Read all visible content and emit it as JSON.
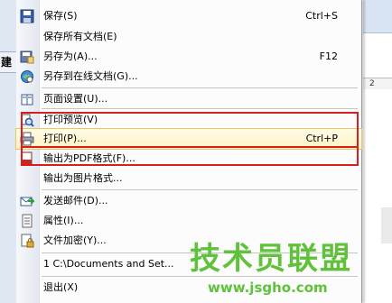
{
  "left_tab": "建",
  "ruler_label": "2",
  "menu": {
    "items": [
      {
        "label": "保存(S)",
        "shortcut": "Ctrl+S"
      },
      {
        "label": "保存所有文档(E)",
        "shortcut": ""
      },
      {
        "label": "另存为(A)...",
        "shortcut": "F12"
      },
      {
        "label": "另存到在线文档(G)...",
        "shortcut": ""
      },
      {
        "label": "页面设置(U)...",
        "shortcut": ""
      },
      {
        "label": "打印预览(V)",
        "shortcut": ""
      },
      {
        "label": "打印(P)...",
        "shortcut": "Ctrl+P"
      },
      {
        "label": "输出为PDF格式(F)...",
        "shortcut": ""
      },
      {
        "label": "输出为图片格式...",
        "shortcut": ""
      },
      {
        "label": "发送邮件(D)...",
        "shortcut": ""
      },
      {
        "label": "属性(I)...",
        "shortcut": ""
      },
      {
        "label": "文件加密(Y)...",
        "shortcut": ""
      },
      {
        "label": "1 C:\\Documents and Set...",
        "shortcut": ""
      },
      {
        "label": "退出(X)",
        "shortcut": ""
      }
    ]
  },
  "watermark": {
    "text": "技术员联盟",
    "url": "www.jsgho.com"
  },
  "colors": {
    "highlight_border": "#d81e1e",
    "watermark": "#5fc23a"
  }
}
